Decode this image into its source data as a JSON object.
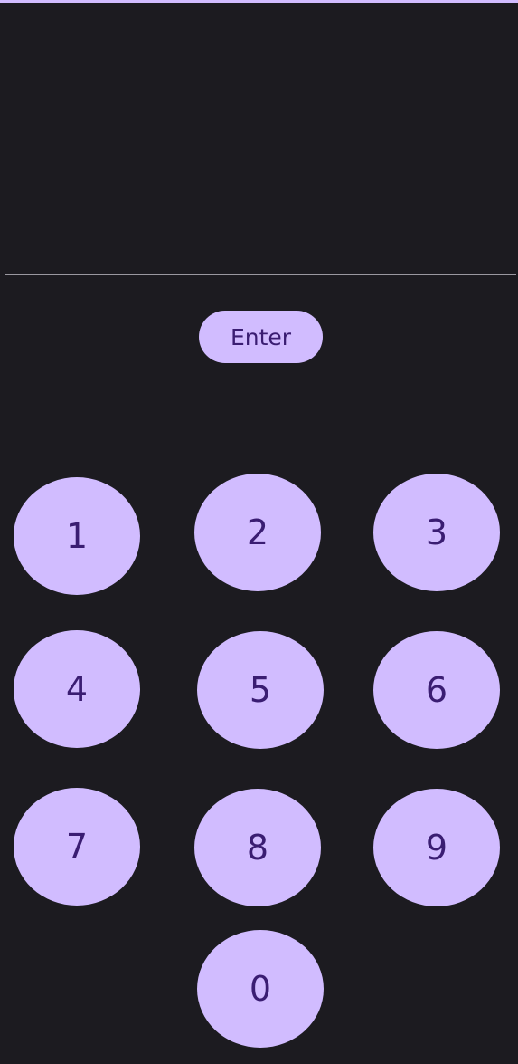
{
  "display": {
    "value": ""
  },
  "enter_button": {
    "label": "Enter"
  },
  "keypad": {
    "keys": [
      "1",
      "2",
      "3",
      "4",
      "5",
      "6",
      "7",
      "8",
      "9",
      "0"
    ]
  },
  "colors": {
    "background": "#1c1b20",
    "accent": "#d1bcff",
    "on_accent": "#3a1d72",
    "divider": "#9a98a0"
  }
}
